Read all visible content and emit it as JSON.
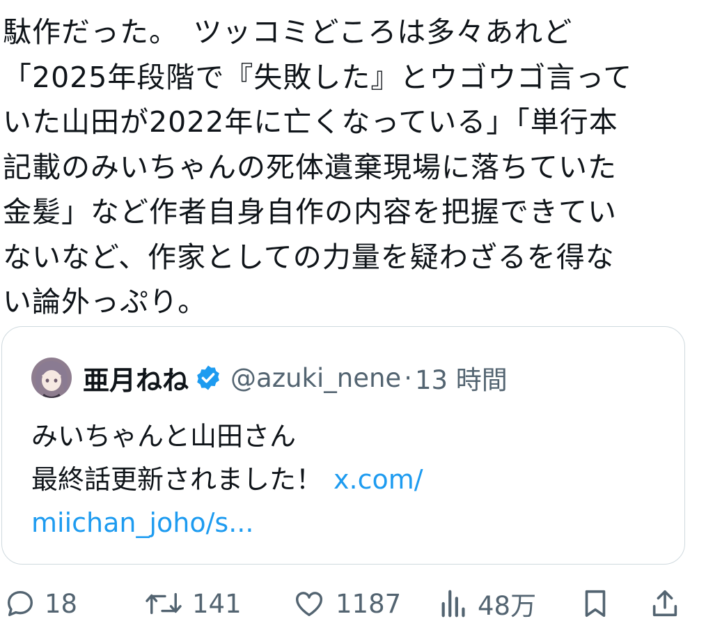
{
  "post": {
    "text_lines": [
      "駄作だった。　ツッコミどころは多々あれど",
      "「2025年段階で『失敗した』とウゴウゴ言って",
      "いた山田が2022年に亡くなっている」「単行本",
      "記載のみいちゃんの死体遺棄現場に落ちていた",
      "金髪」など作者自身自作の内容を把握できてい",
      "ないなど、作家としての力量を疑わざるを得な",
      "い論外っぷり。"
    ]
  },
  "quote": {
    "name": "亜月ねね",
    "handle": "@azuki_nene",
    "dot": "·",
    "time": "13 時間",
    "line1": "みいちゃんと山田さん",
    "line2": "最終話更新されました！",
    "link_line1": "x.com/",
    "link_line2": "miichan_joho/s..."
  },
  "actions": {
    "replies": "18",
    "reposts": "141",
    "likes": "1187",
    "views": "48万"
  },
  "colors": {
    "text": "#0f1419",
    "secondary": "#536471",
    "link": "#1d9bf0",
    "verified": "#1d9bf0",
    "border": "#cfd9de"
  },
  "icons": [
    "verified-badge-icon",
    "reply-icon",
    "repost-icon",
    "like-icon",
    "views-icon",
    "bookmark-icon",
    "share-icon"
  ]
}
